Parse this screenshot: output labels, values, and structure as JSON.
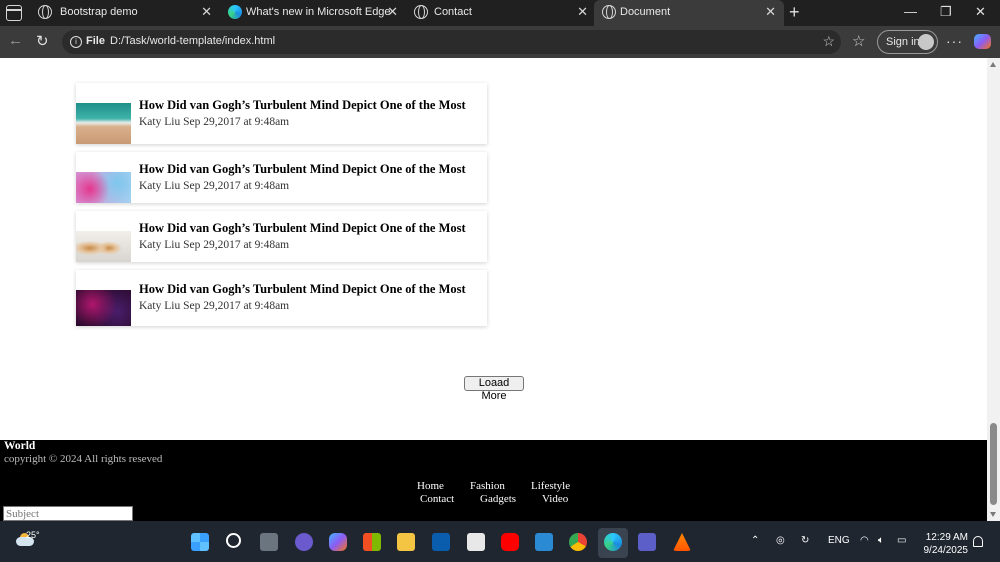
{
  "browser": {
    "tabs": [
      {
        "title": "Bootstrap demo",
        "icon": "globe-icon",
        "active": false
      },
      {
        "title": "What's new in Microsoft Edge",
        "icon": "edge-icon",
        "active": false
      },
      {
        "title": "Contact",
        "icon": "globe-icon",
        "active": false
      },
      {
        "title": "Document",
        "icon": "globe-icon",
        "active": true
      }
    ],
    "address": {
      "scheme": "File",
      "url": "D:/Task/world-template/index.html"
    },
    "signin_label": "Sign in"
  },
  "page": {
    "articles": [
      {
        "title": "How Did van Gogh’s Turbulent Mind Depict One of the Most",
        "meta": "Katy Liu Sep 29,2017 at 9:48am",
        "image": "beach-thumbnail"
      },
      {
        "title": "How Did van Gogh’s Turbulent Mind Depict One of the Most",
        "meta": "Katy Liu Sep 29,2017 at 9:48am",
        "image": "pink-smoke-thumbnail"
      },
      {
        "title": "How Did van Gogh’s Turbulent Mind Depict One of the Most",
        "meta": "Katy Liu Sep 29,2017 at 9:48am",
        "image": "coffee-thumbnail"
      },
      {
        "title": "How Did van Gogh’s Turbulent Mind Depict One of the Most",
        "meta": "Katy Liu Sep 29,2017 at 9:48am",
        "image": "purple-texture-thumbnail"
      }
    ],
    "load_more_label": "Loaad More",
    "footer": {
      "brand": "World",
      "copyright": "copyright © 2024 All rights reseved",
      "links_row1": [
        "Home",
        "Fashion",
        "Lifestyle"
      ],
      "links_row2": [
        "Contact",
        "Gadgets",
        "Video"
      ],
      "subject_placeholder": "Subject"
    }
  },
  "taskbar": {
    "temperature": "25°",
    "time": "12:29 AM",
    "date": "9/24/2025",
    "language": "ENG"
  }
}
